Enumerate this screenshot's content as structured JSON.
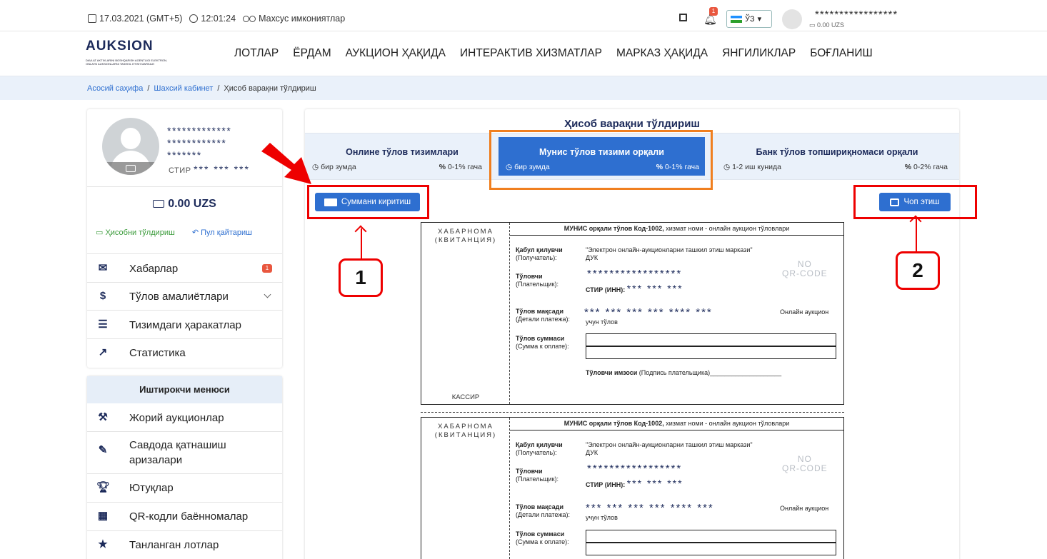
{
  "topbar": {
    "date": "17.03.2021 (GMT+5)",
    "time": "12:01:24",
    "accessibility": "Махсус имкониятлар",
    "notif_count": "1",
    "lang": "ЎЗ",
    "user_name": "*****************",
    "user_balance": "0.00 UZS"
  },
  "nav": {
    "logo": "AUKSION",
    "logo_sub": "DAVLAT AKTIVLARINI BOSHQARISH AGENTLIGI ELEKTRON-ONLAYN AUKSIONLARNI TASHKIL ETISH MARKAZI",
    "items": [
      "ЛОТЛАР",
      "ЁРДАМ",
      "АУКЦИОН ҲАҚИДА",
      "ИНТЕРАКТИВ ХИЗМАТЛАР",
      "МАРКАЗ ҲАҚИДА",
      "ЯНГИЛИКЛАР",
      "БОҒЛАНИШ"
    ]
  },
  "breadcrumb": {
    "home": "Асосий саҳифа",
    "cabinet": "Шахсий кабинет",
    "current": "Ҳисоб варақни тўлдириш",
    "sep": "/"
  },
  "profile": {
    "name1": "*************",
    "name2": "************",
    "name3": "*******",
    "stir_label": "СТИР",
    "stir_value": "*** *** ***",
    "balance": "0.00 UZS",
    "topup": "Ҳисобни тўлдириш",
    "refund": "Пул қайтариш",
    "menu": [
      {
        "label": "Хабарлар",
        "badge": "1"
      },
      {
        "label": "Тўлов амалиётлари"
      },
      {
        "label": "Тизимдаги ҳаракатлар"
      },
      {
        "label": "Статистика"
      }
    ]
  },
  "participant_menu": {
    "title": "Иштирокчи менюси",
    "items": [
      "Жорий аукционлар",
      "Савдода қатнашиш",
      "аризалари",
      "Ютуқлар",
      "QR-кодли баённомалар",
      "Танланган лотлар"
    ]
  },
  "main": {
    "title": "Ҳисоб варақни тўлдириш",
    "tabs": [
      {
        "title": "Онлине тўлов тизимлари",
        "time": "бир зумда",
        "fee": "0-1% гача"
      },
      {
        "title": "Мунис тўлов тизими орқали",
        "time": "бир зумда",
        "fee": "0-1% гача"
      },
      {
        "title": "Банк тўлов топшириқномаси орқали",
        "time": "1-2 иш кунида",
        "fee": "0-2% гача"
      }
    ],
    "enter_sum_button": "Суммани киритиш",
    "print_button": "Чоп этиш",
    "marker1": "1",
    "marker2": "2"
  },
  "receipt": {
    "hab": "ХАБАРНОМА",
    "kvit": "(КВИТАНЦИЯ)",
    "kassir": "КАССИР",
    "header_bold": "МУНИС орқали тўлов Код-1002,",
    "header_rest": " хизмат номи - онлайн аукцион тўловлари",
    "recipient_label": "Қабул қилувчи",
    "recipient_ru": "(Получатель):",
    "recipient_value": "\"Электрон онлайн-аукционларни ташкил этиш маркази\"",
    "recipient_value2": "ДУК",
    "payer_label": "Тўловчи",
    "payer_ru": "(Плательщик):",
    "payer_stars": "*****************",
    "payer_stir": "СТИР (ИНН):",
    "payer_stir_value": "*** *** ***",
    "purpose_label": "Тўлов мақсади",
    "purpose_ru": "(Детали платежа):",
    "purpose_stars": "*** *** *** *** **** ***",
    "purpose_value": "учун тўлов",
    "purpose_right": "Онлайн аукцион",
    "sum_label": "Тўлов суммаси",
    "sum_ru": "(Сумма к оплате):",
    "sign_bold": "Тўловчи имзоси",
    "sign_rest": " (Подпись плательщика)____________________",
    "no_qr": "NO",
    "no_qr2": "QR-CODE"
  }
}
